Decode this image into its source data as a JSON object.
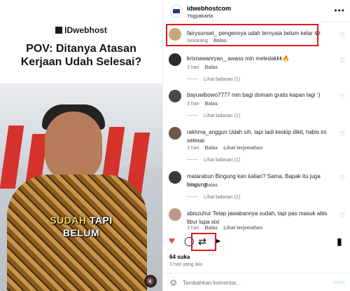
{
  "media": {
    "brand": "IDwebhost",
    "headline": [
      "POV: Ditanya Atasan",
      "Kerjaan Udah Selesai?"
    ],
    "caption_highlight": "SUDAH",
    "caption_rest": "TAPI",
    "caption_line2": "BELUM",
    "mute_icon": "speaker-muted-icon"
  },
  "header": {
    "username": "idwebhostcom",
    "location": "Yogyakarta",
    "more_icon": "ellipsis-icon"
  },
  "comments": [
    {
      "user": "fairysunset_",
      "text": "pengennya udah ternyata belum kelar 😭",
      "time": "Sekarang",
      "reply": "Balas",
      "highlighted": true
    },
    {
      "user": "krisnawanryan_",
      "text": "awass min meledakkk🔥",
      "time": "3 hari",
      "reply": "Balas",
      "view_replies": "Lihat balasan (1)"
    },
    {
      "user": "bayuwibowo7777",
      "text": "min bagi domain gratis kapan lagi :)",
      "time": "3 hari",
      "reply": "Balas",
      "view_replies": "Lihat balasan (1)"
    },
    {
      "user": "rakhma_anggun",
      "text": "Udah sih, tapi tadi keskip dikit, habis ini selesai",
      "time": "3 hari",
      "reply": "Balas",
      "translate": "Lihat terjemahan",
      "view_replies": "Lihat balasan (1)"
    },
    {
      "user": "matarabun",
      "text": "Bingung kan kalian? Sama, Bapak itu juga bingung",
      "time": "3 hari",
      "reply": "Balas",
      "view_replies": "Lihat balasan (1)"
    },
    {
      "user": "abiszuhur",
      "text": "Tetap jawabannya sudah, tapi pas masuk abis libur lupa xixi",
      "time": "3 hari",
      "reply": "Balas",
      "translate": "Lihat terjemahan"
    }
  ],
  "footer": {
    "likes": "64 suka",
    "date": "3 hari yang lalu",
    "comment_placeholder": "Tambahkan komentar...",
    "post_label": "Kirim"
  },
  "colors": {
    "like_red": "#ed4956",
    "highlight_red": "#e0191c",
    "muted_text": "#737373"
  }
}
